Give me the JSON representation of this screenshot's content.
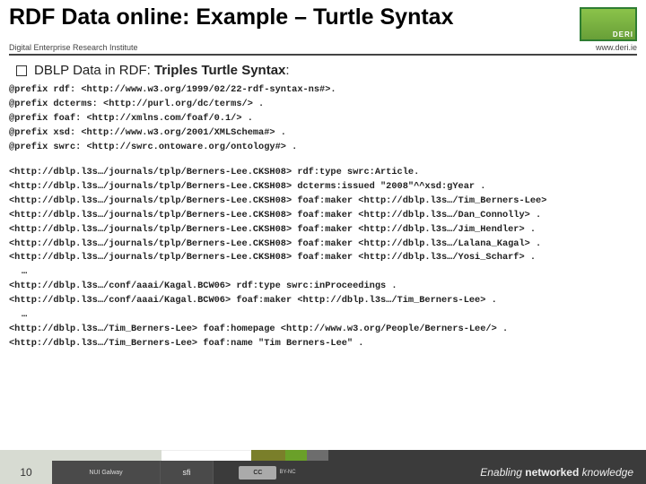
{
  "title": "RDF Data online: Example – Turtle Syntax",
  "institute": "Digital Enterprise Research Institute",
  "site": "www.deri.ie",
  "logo_text": "DERI",
  "bullet": {
    "prefix": "DBLP Data in RDF: ",
    "bold": "Triples Turtle Syntax",
    "suffix": ":"
  },
  "prefixes": [
    "@prefix rdf: <http://www.w3.org/1999/02/22-rdf-syntax-ns#>.",
    "@prefix dcterms: <http://purl.org/dc/terms/> .",
    "@prefix foaf: <http://xmlns.com/foaf/0.1/> .",
    "@prefix xsd: <http://www.w3.org/2001/XMLSchema#> .",
    "@prefix swrc: <http://swrc.ontoware.org/ontology#> ."
  ],
  "triples1": [
    "<http://dblp.l3s…/journals/tplp/Berners-Lee.CKSH08> rdf:type swrc:Article.",
    "<http://dblp.l3s…/journals/tplp/Berners-Lee.CKSH08> dcterms:issued \"2008\"^^xsd:gYear .",
    "<http://dblp.l3s…/journals/tplp/Berners-Lee.CKSH08> foaf:maker <http://dblp.l3s…/Tim_Berners-Lee>",
    "<http://dblp.l3s…/journals/tplp/Berners-Lee.CKSH08> foaf:maker <http://dblp.l3s…/Dan_Connolly> .",
    "<http://dblp.l3s…/journals/tplp/Berners-Lee.CKSH08> foaf:maker <http://dblp.l3s…/Jim_Hendler> .",
    "<http://dblp.l3s…/journals/tplp/Berners-Lee.CKSH08> foaf:maker <http://dblp.l3s…/Lalana_Kagal> .",
    "<http://dblp.l3s…/journals/tplp/Berners-Lee.CKSH08> foaf:maker <http://dblp.l3s…/Yosi_Scharf> ."
  ],
  "ell": "…",
  "triples2": [
    "<http://dblp.l3s…/conf/aaai/Kagal.BCW06> rdf:type swrc:inProceedings .",
    "<http://dblp.l3s…/conf/aaai/Kagal.BCW06> foaf:maker <http://dblp.l3s…/Tim_Berners-Lee> ."
  ],
  "triples3": [
    "<http://dblp.l3s…/Tim_Berners-Lee> foaf:homepage <http://www.w3.org/People/Berners-Lee/> .",
    "<http://dblp.l3s…/Tim_Berners-Lee> foaf:name \"Tim Berners-Lee\" ."
  ],
  "footer": {
    "page": "10",
    "uni": "NUI Galway",
    "sfi": "sfi",
    "cc": "CC",
    "cc_sub": "BY-NC",
    "tagline_pre": "Enabling ",
    "tagline_bold": "networked",
    "tagline_post": " knowledge"
  }
}
